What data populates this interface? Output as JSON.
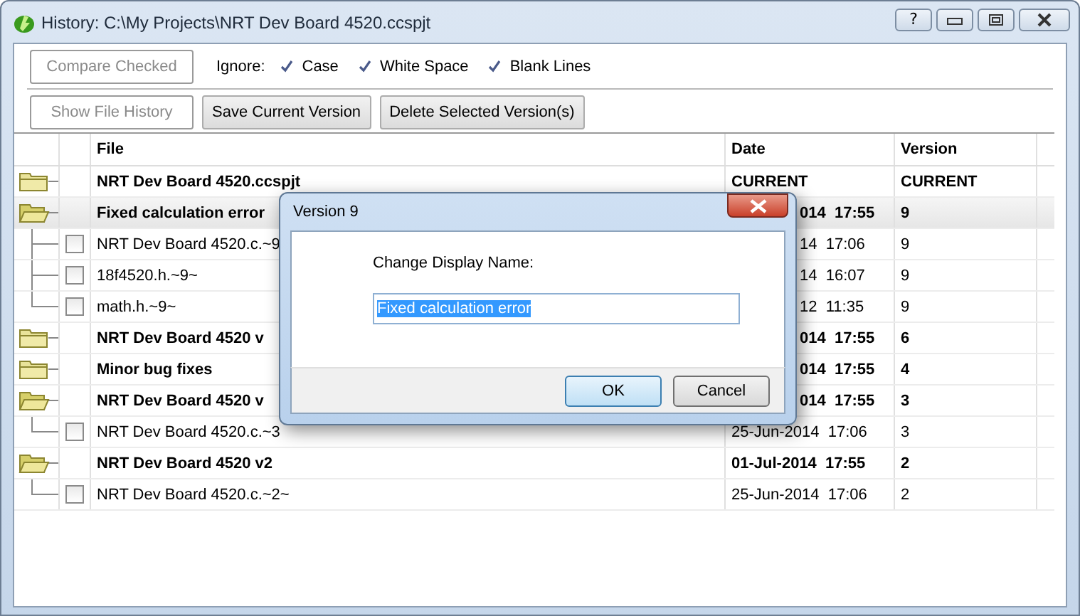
{
  "window": {
    "title": "History: C:\\My Projects\\NRT Dev Board 4520.ccspjt",
    "help": "?"
  },
  "toolbar": {
    "compare_button": {
      "label": "Compare Checked",
      "disabled": true
    },
    "ignore_label": "Ignore:",
    "ignore_options": [
      {
        "label": "Case",
        "checked": true
      },
      {
        "label": "White Space",
        "checked": true
      },
      {
        "label": "Blank Lines",
        "checked": true
      }
    ],
    "buttons": [
      {
        "label": "Show File History",
        "disabled": true
      },
      {
        "label": "Save Current Version",
        "disabled": false
      },
      {
        "label": "Delete Selected Version(s)",
        "disabled": false
      }
    ]
  },
  "table": {
    "columns": [
      "File",
      "Date",
      "Version"
    ],
    "versions": [
      {
        "name": "NRT Dev Board 4520.ccspjt",
        "date": "CURRENT",
        "version": "CURRENT",
        "expanded": false,
        "selected": false,
        "covered": false
      },
      {
        "name": "Fixed calculation error",
        "date": "014  17:55",
        "version": "9",
        "expanded": true,
        "selected": true,
        "covered": true,
        "children": [
          {
            "name": "NRT Dev Board 4520.c.~9",
            "date": "14  17:06",
            "version": "9",
            "checked": false,
            "covered": true
          },
          {
            "name": "18f4520.h.~9~",
            "date": "14  16:07",
            "version": "9",
            "checked": false,
            "covered": true
          },
          {
            "name": "math.h.~9~",
            "date": "12  11:35",
            "version": "9",
            "checked": false,
            "covered": true
          }
        ]
      },
      {
        "name": "NRT Dev Board 4520 v",
        "date": "014  17:55",
        "version": "6",
        "expanded": false,
        "selected": false,
        "covered": true
      },
      {
        "name": "Minor bug fixes",
        "date": "014  17:55",
        "version": "4",
        "expanded": false,
        "selected": false,
        "covered": true
      },
      {
        "name": "NRT Dev Board 4520 v",
        "date": "014  17:55",
        "version": "3",
        "expanded": true,
        "selected": false,
        "covered": true,
        "children": [
          {
            "name": "NRT Dev Board 4520.c.~3",
            "date": "25-Jun-2014  17:06",
            "version": "3",
            "checked": false,
            "covered": false
          }
        ]
      },
      {
        "name": "NRT Dev Board 4520 v2",
        "date": "01-Jul-2014  17:55",
        "version": "2",
        "expanded": true,
        "selected": false,
        "covered": false,
        "children": [
          {
            "name": "NRT Dev Board 4520.c.~2~",
            "date": "25-Jun-2014  17:06",
            "version": "2",
            "checked": false,
            "covered": false
          }
        ]
      }
    ]
  },
  "dialog": {
    "title": "Version 9",
    "label": "Change Display Name:",
    "value": "Fixed calculation error",
    "value_selected": true,
    "buttons": [
      {
        "label": "OK",
        "default": true
      },
      {
        "label": "Cancel",
        "default": false
      }
    ]
  }
}
